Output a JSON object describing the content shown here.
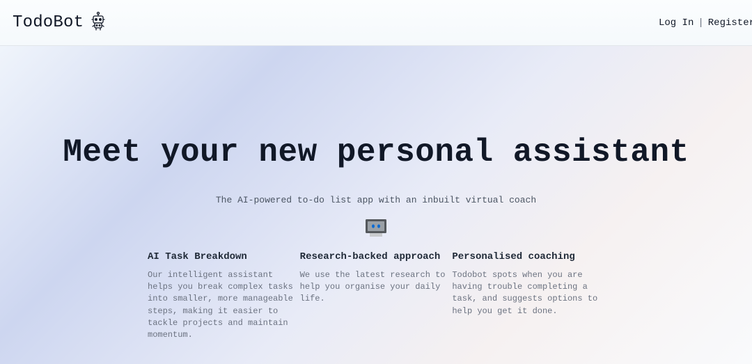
{
  "header": {
    "brand": "TodoBot",
    "login": "Log In",
    "register": "Register"
  },
  "hero": {
    "title": "Meet your new personal assistant",
    "tagline": "The AI-powered to-do list app with an inbuilt virtual coach"
  },
  "features": [
    {
      "title": "AI Task Breakdown",
      "desc": "Our intelligent assistant helps you break complex tasks into smaller, more manageable steps, making it easier to tackle projects and maintain momentum."
    },
    {
      "title": "Research-backed approach",
      "desc": "We use the latest research to help you organise your daily life."
    },
    {
      "title": "Personalised coaching",
      "desc": "Todobot spots when you are having trouble completing a task, and suggests options to help you get it done."
    }
  ]
}
